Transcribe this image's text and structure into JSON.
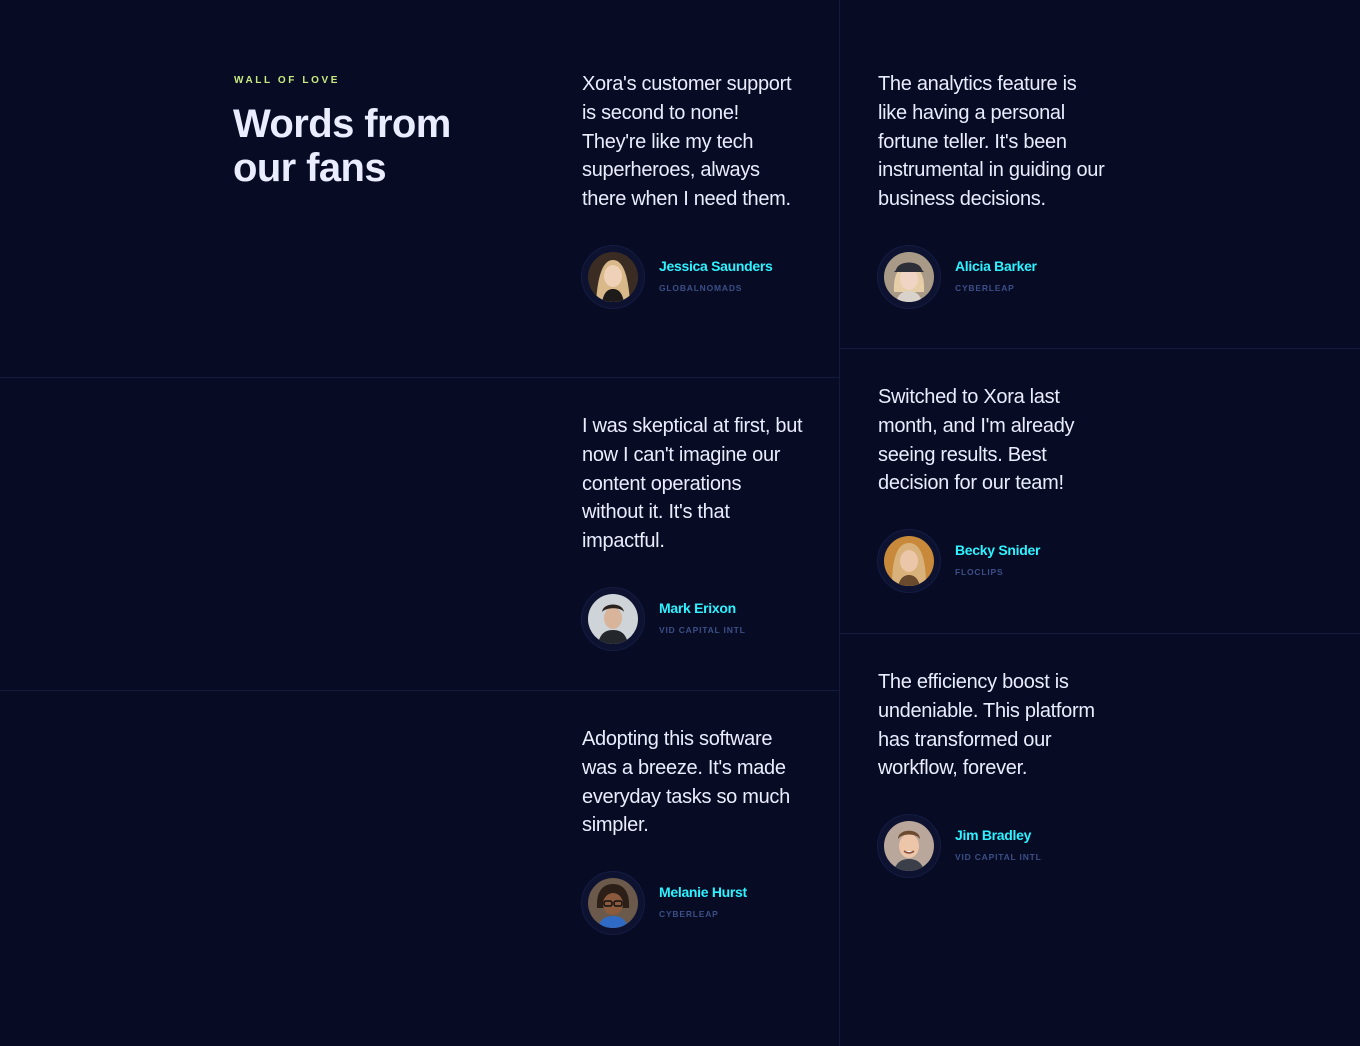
{
  "section": {
    "eyebrow": "Wall of Love",
    "heading": "Words from our fans"
  },
  "testimonials": [
    {
      "quote": "Xora's customer support is second to none! They're like my tech superheroes, always there when I need them.",
      "name": "Jessica Saunders",
      "company": "Globalnomads",
      "avatar_icon": "avatar-woman-blonde"
    },
    {
      "quote": "I was skeptical at first, but now I can't imagine our content operations without it. It's that impactful.",
      "name": "Mark Erixon",
      "company": "Vid Capital Intl",
      "avatar_icon": "avatar-man-dark-hair"
    },
    {
      "quote": "Adopting this software was a breeze. It's made everyday tasks so much simpler.",
      "name": "Melanie Hurst",
      "company": "Cyberleap",
      "avatar_icon": "avatar-woman-glasses"
    },
    {
      "quote": "The analytics feature is like having a personal fortune teller. It's been instrumental in guiding our business decisions.",
      "name": "Alicia Barker",
      "company": "Cyberleap",
      "avatar_icon": "avatar-woman-cap"
    },
    {
      "quote": "Switched to Xora last month, and I'm already seeing results. Best decision for our team!",
      "name": "Becky Snider",
      "company": "Floclips",
      "avatar_icon": "avatar-woman-blonde-outdoor"
    },
    {
      "quote": "The efficiency boost is undeniable. This platform has transformed our workflow, forever.",
      "name": "Jim Bradley",
      "company": "Vid Capital Intl",
      "avatar_icon": "avatar-man-smiling"
    }
  ],
  "colors": {
    "background": "#070b24",
    "divider": "#141a3c",
    "eyebrow": "#c8ea80",
    "heading": "#eaedff",
    "name": "#2ef2ff",
    "company": "#3c4f86"
  }
}
